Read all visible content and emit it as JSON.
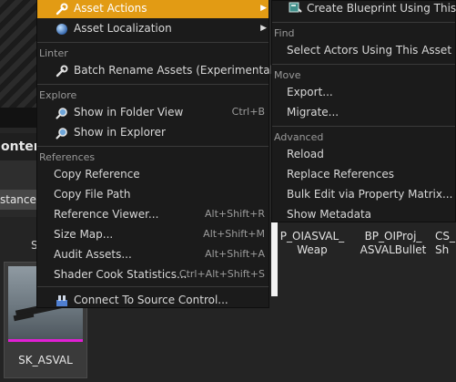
{
  "background": {
    "content_tab_fragment": "ontent",
    "filter_chip_fragment": "stance",
    "tile_fragment": "S",
    "asset_tile": {
      "name": "SK_ASVAL",
      "bar_color": "#e11fd4"
    },
    "grid_labels": [
      {
        "line1": "P_OIASVAL_",
        "line2": "Weap"
      },
      {
        "line1": "BP_OIProj_",
        "line2": "ASVALBullet"
      },
      {
        "line1": "CS_",
        "line2": "Sh"
      }
    ]
  },
  "menu": {
    "accent_color": "#e29b14",
    "top_items": [
      {
        "label": "Asset Actions",
        "icon": "wrench-icon",
        "has_submenu": true,
        "highlighted": true
      },
      {
        "label": "Asset Localization",
        "icon": "globe-icon",
        "has_submenu": true,
        "highlighted": false
      }
    ],
    "linter": {
      "header": "Linter",
      "items": [
        {
          "label": "Batch Rename Assets (Experimental)",
          "icon": "wrench-icon"
        }
      ]
    },
    "explore": {
      "header": "Explore",
      "items": [
        {
          "label": "Show in Folder View",
          "icon": "magnifier-icon",
          "shortcut": "Ctrl+B"
        },
        {
          "label": "Show in Explorer",
          "icon": "magnifier-icon",
          "shortcut": ""
        }
      ]
    },
    "references": {
      "header": "References",
      "items": [
        {
          "label": "Copy Reference",
          "shortcut": ""
        },
        {
          "label": "Copy File Path",
          "shortcut": ""
        },
        {
          "label": "Reference Viewer...",
          "shortcut": "Alt+Shift+R"
        },
        {
          "label": "Size Map...",
          "shortcut": "Alt+Shift+M"
        },
        {
          "label": "Audit Assets...",
          "shortcut": "Alt+Shift+A"
        },
        {
          "label": "Shader Cook Statistics...",
          "shortcut": "Ctrl+Alt+Shift+S"
        }
      ]
    },
    "source_control": {
      "label": "Connect To Source Control...",
      "icon": "source-control-icon"
    }
  },
  "submenu": {
    "top_item": {
      "label": "Create Blueprint Using This...",
      "icon": "blueprint-icon"
    },
    "find": {
      "header": "Find",
      "items": [
        "Select Actors Using This Asset"
      ]
    },
    "move": {
      "header": "Move",
      "items": [
        "Export...",
        "Migrate..."
      ]
    },
    "advanced": {
      "header": "Advanced",
      "items": [
        "Reload",
        "Replace References",
        "Bulk Edit via Property Matrix...",
        "Show Metadata"
      ]
    }
  }
}
